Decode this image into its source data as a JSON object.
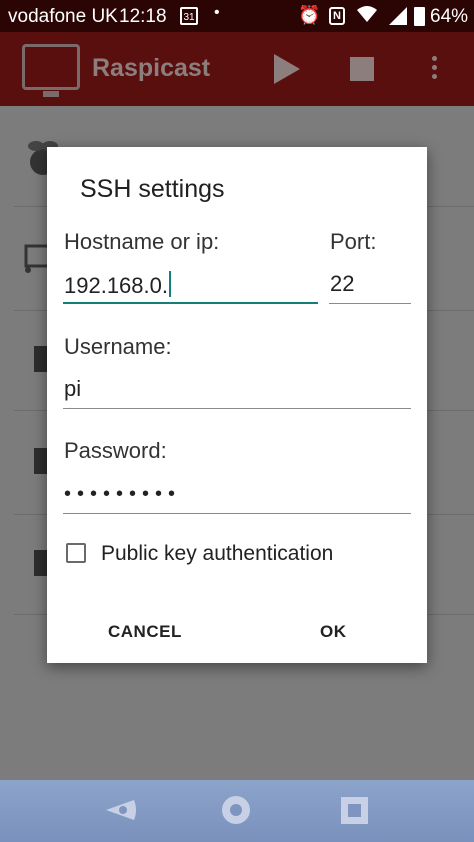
{
  "status_bar": {
    "carrier": "vodafone UK",
    "time": "12:18",
    "calendar_day": "31",
    "dot": "•",
    "battery_percent": "64%",
    "icons": [
      "calendar-icon",
      "alarm-icon",
      "nfc-icon",
      "wifi-icon",
      "signal-icon",
      "battery-icon"
    ]
  },
  "app_bar": {
    "title": "Raspicast",
    "icons": [
      "raspicast-logo-icon",
      "play-icon",
      "stop-icon",
      "more-vert-icon"
    ]
  },
  "dialog": {
    "title": "SSH settings",
    "hostname_label": "Hostname or ip:",
    "hostname_value": "192.168.0.",
    "port_label": "Port:",
    "port_value": "22",
    "username_label": "Username:",
    "username_value": "pi",
    "password_label": "Password:",
    "password_masked": "•••••••••",
    "public_key_label": "Public key authentication",
    "public_key_checked": false,
    "cancel_label": "CANCEL",
    "ok_label": "OK"
  },
  "colors": {
    "status_bar": "#2b0404",
    "app_bar": "#5a0f0f",
    "accent": "#137e7a",
    "nav_bar": "#8ca3ca"
  }
}
